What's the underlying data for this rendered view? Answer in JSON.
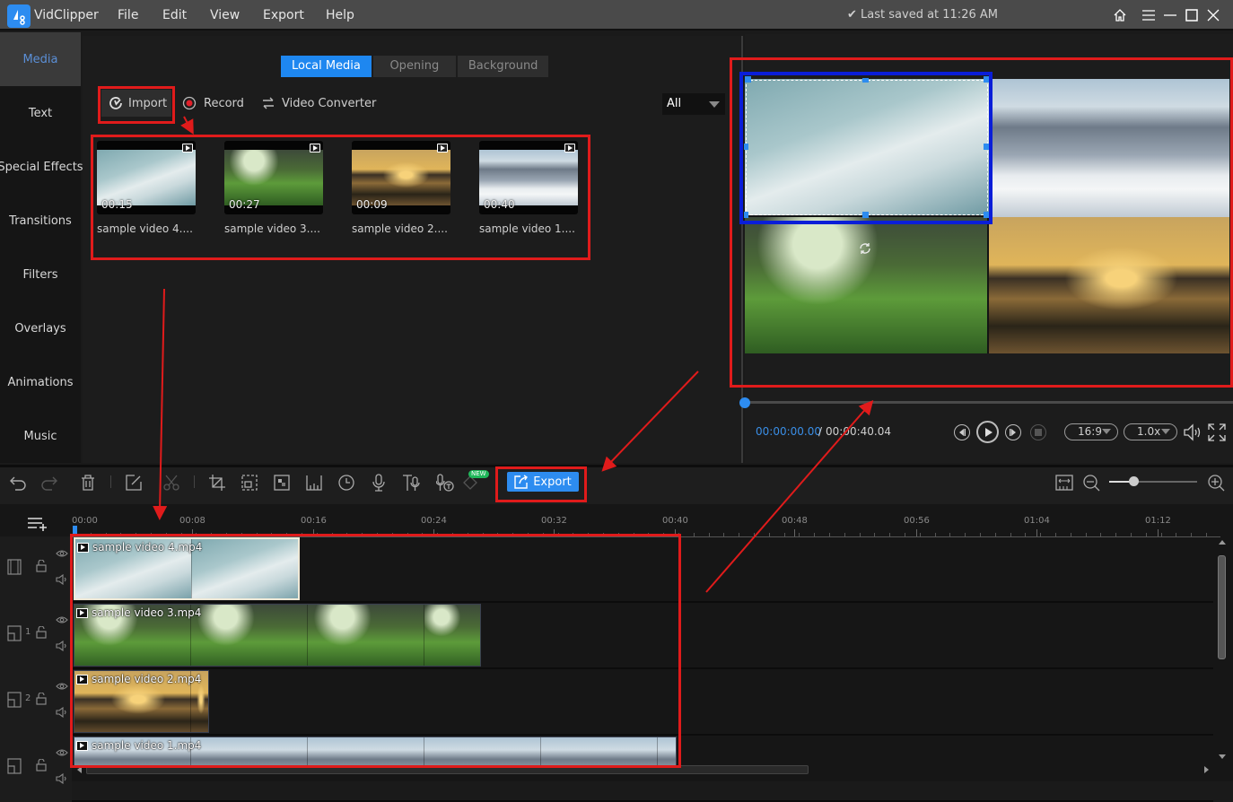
{
  "titlebar": {
    "app_name": "VidClipper",
    "menus": [
      "File",
      "Edit",
      "View",
      "Export",
      "Help"
    ],
    "save_status": "Last saved at 11:26 AM"
  },
  "sidebar": {
    "items": [
      {
        "label": "Media",
        "active": true
      },
      {
        "label": "Text"
      },
      {
        "label": "Special Effects"
      },
      {
        "label": "Transitions"
      },
      {
        "label": "Filters"
      },
      {
        "label": "Overlays"
      },
      {
        "label": "Animations"
      },
      {
        "label": "Music"
      }
    ]
  },
  "media": {
    "tabs": [
      {
        "label": "Local Media",
        "active": true
      },
      {
        "label": "Opening"
      },
      {
        "label": "Background"
      }
    ],
    "actions": {
      "import": "Import",
      "record": "Record",
      "converter": "Video Converter"
    },
    "filter": {
      "selected": "All"
    },
    "items": [
      {
        "name": "sample video 4....",
        "duration": "00:15",
        "thumb": "sky"
      },
      {
        "name": "sample video 3....",
        "duration": "00:27",
        "thumb": "grass"
      },
      {
        "name": "sample video 2....",
        "duration": "00:09",
        "thumb": "sunset"
      },
      {
        "name": "sample video 1....",
        "duration": "00:40",
        "thumb": "mount"
      }
    ]
  },
  "preview": {
    "current_time": "00:00:00.00",
    "separator": "/",
    "total_time": "00:00:40.04",
    "aspect_ratio": "16:9",
    "speed": "1.0x",
    "playback_progress": 0
  },
  "toolbar": {
    "export_label": "Export",
    "new_badge": "NEW",
    "timeline_zoom_level": 0.28
  },
  "timeline": {
    "ruler": [
      "00:00",
      "00:08",
      "00:16",
      "00:24",
      "00:32",
      "00:40",
      "00:48",
      "00:56",
      "01:04",
      "01:12"
    ],
    "tracks": [
      {
        "head": "",
        "clip": "sample video 4.mp4",
        "thumb": "sky",
        "duration_s": 15
      },
      {
        "head": "1",
        "clip": "sample video 3.mp4",
        "thumb": "grass",
        "duration_s": 27
      },
      {
        "head": "2",
        "clip": "sample video 2.mp4",
        "thumb": "sunset",
        "duration_s": 9
      },
      {
        "head": "",
        "clip": "sample video 1.mp4",
        "thumb": "mount",
        "duration_s": 40
      }
    ]
  }
}
